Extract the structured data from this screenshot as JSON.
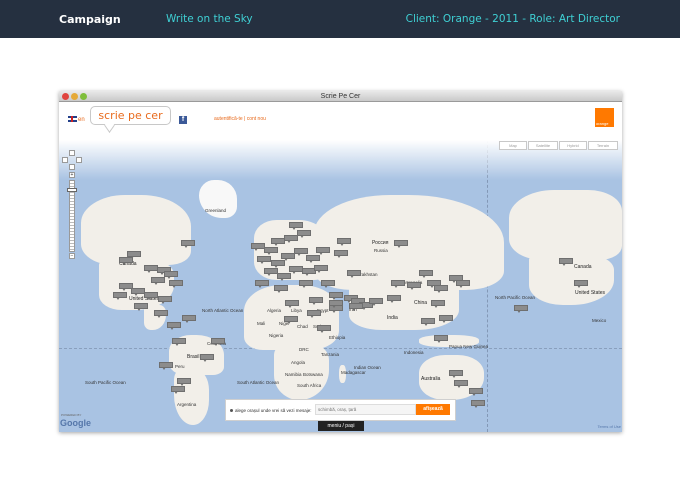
{
  "topbar": {
    "brand": "Campaign",
    "project": "Write on the Sky",
    "client": "Client: Orange - 2011 - Role: Art Director"
  },
  "window": {
    "title": "Scrie Pe Cer"
  },
  "app": {
    "lang": "en",
    "logo_text": "scrie pe cer",
    "auth": "autentifică-te | cont nou",
    "brand_logo": "orange"
  },
  "map": {
    "types": [
      "Map",
      "Satellite",
      "Hybrid",
      "Terrain"
    ],
    "labels": {
      "greenland": "Greenland",
      "canada": "Canada",
      "united_states": "United States",
      "north_atlantic": "North Atlantic Ocean",
      "north_pacific": "North Pacific Ocean",
      "south_atlantic": "South Atlantic Ocean",
      "south_pacific": "South Pacific Ocean",
      "indian_ocean": "Indian Ocean",
      "brasil": "Brasil",
      "peru": "Peru",
      "bolivia": "Bolivia",
      "argentina": "Argentina",
      "colombia": "Colombia",
      "venezuela": "Venezuela",
      "algeria": "Algeria",
      "libya": "Libya",
      "egypt": "Egypt",
      "mali": "Mali",
      "niger": "Niger",
      "chad": "Chad",
      "sudan": "Sudan",
      "nigeria": "Nigeria",
      "ethiopia": "Ethiopia",
      "drc": "DRC",
      "angola": "Angola",
      "namibia": "Namibia",
      "botswana": "Botswana",
      "south_africa": "South Africa",
      "tanzania": "Tanzania",
      "madagascar": "Madagascar",
      "kazakhstan": "Kazakhstan",
      "russia": "Россия",
      "russia_en": "Russia",
      "mongolia": "Mongolia",
      "china": "China",
      "india": "India",
      "iran": "Iran",
      "indonesia": "Indonesia",
      "australia": "Australia",
      "papua": "Papua New Guinea",
      "canada_right": "Canada",
      "united_states_right": "United States",
      "mexico": "Mexico"
    },
    "search": {
      "prompt": "alege orașul unde vrei să vezi mesaje:",
      "placeholder": "schimbă, oraș, țară",
      "button": "afișează"
    },
    "menu_button": "meniu / pași",
    "google": "Google",
    "powered": "POWERED BY",
    "terms": "Terms of Use"
  },
  "colors": {
    "topbar_bg": "#253040",
    "accent_cyan": "#3fd0d4",
    "orange": "#ff7900",
    "ocean": "#a9c3e3",
    "land": "#f2efe9"
  }
}
